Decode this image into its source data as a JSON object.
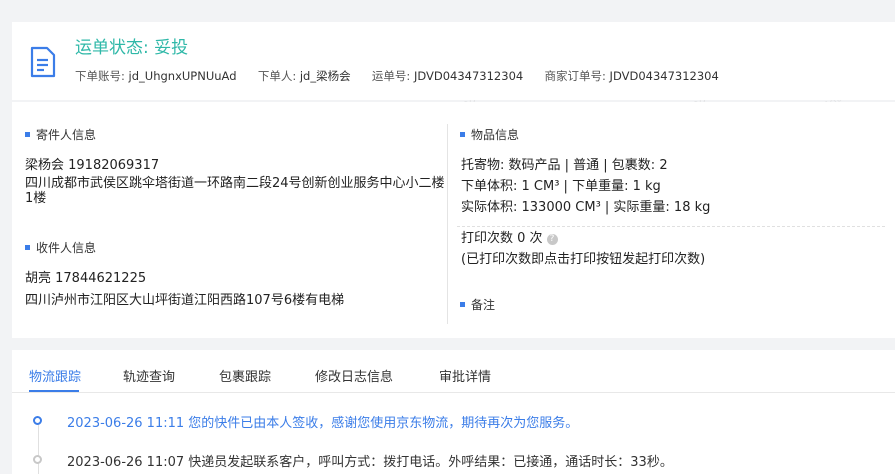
{
  "header": {
    "status_text": "运单状态: 妥投",
    "account_label": "下单账号:",
    "account_value": "jd_UhgnxUPNUuAd",
    "orderer_label": "下单人:",
    "orderer_value": "jd_梁杨会",
    "waybill_label": "运单号:",
    "waybill_value": "JDVD04347312304",
    "merchant_order_label": "商家订单号:",
    "merchant_order_value": "JDVD04347312304"
  },
  "sender": {
    "section_title": "寄件人信息",
    "name_phone": "梁杨会   19182069317",
    "address": "四川成都市武侯区跳伞塔街道一环路南二段24号创新创业服务中心小二楼1楼"
  },
  "receiver": {
    "section_title": "收件人信息",
    "name_phone": "胡亮   17844621225",
    "address": "四川泸州市江阳区大山坪街道江阳西路107号6楼有电梯"
  },
  "goods": {
    "section_title": "物品信息",
    "line1": "托寄物:  数码产品 | 普通  |  包裹数:  2",
    "line2": "下单体积:   1 CM³  |  下单重量:   1 kg",
    "line3": "实际体积:   133000 CM³  |  实际重量:   18 kg",
    "print_label": "打印次数   0 次",
    "print_hint": "(已打印次数即点击打印按钮发起打印次数)"
  },
  "remarks": {
    "section_title": "备注"
  },
  "tabs": [
    {
      "label": "物流跟踪"
    },
    {
      "label": "轨迹查询"
    },
    {
      "label": "包裹跟踪"
    },
    {
      "label": "修改日志信息"
    },
    {
      "label": "审批详情"
    }
  ],
  "timeline": [
    {
      "text": "2023-06-26 11:11  您的快件已由本人签收，感谢您使用京东物流，期待再次为您服务。"
    },
    {
      "text": "2023-06-26 11:07  快递员发起联系客户，呼叫方式：拨打电话。外呼结果：已接通，通话时长：33秒。"
    }
  ],
  "colors": {
    "status": "#2fb8a8",
    "accent": "#3b7de8"
  }
}
